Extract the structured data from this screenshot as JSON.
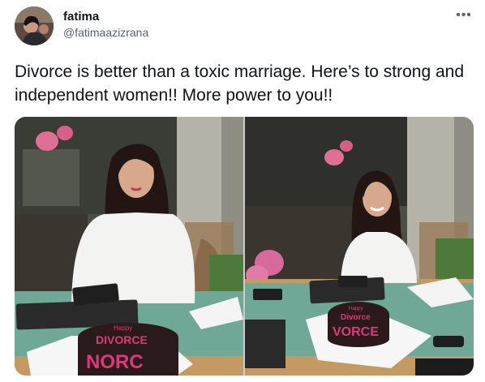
{
  "user": {
    "display_name": "fatima",
    "handle": "@fatimaazizrana",
    "avatar_icon": "profile-photo"
  },
  "menu": {
    "more_icon": "more-horizontal-icon",
    "glyph": "•••"
  },
  "tweet": {
    "text": "Divorce is better than a toxic marriage. Here’s to strong and independent women!! More power to you!!"
  },
  "media": {
    "left_cake_text_top": "Happy",
    "left_cake_text_main": "DIVORCE",
    "left_cake_text_bottom": "NORC",
    "right_cake_text_top": "Happy",
    "right_cake_text_main": "Divorce",
    "right_cake_text_bottom": "VORCE",
    "colors": {
      "cake": "#2a1a1c",
      "icing": "#e0367a",
      "shirt": "#f3f3f1",
      "table": "#c49a62",
      "mat": "#6fa896"
    }
  }
}
